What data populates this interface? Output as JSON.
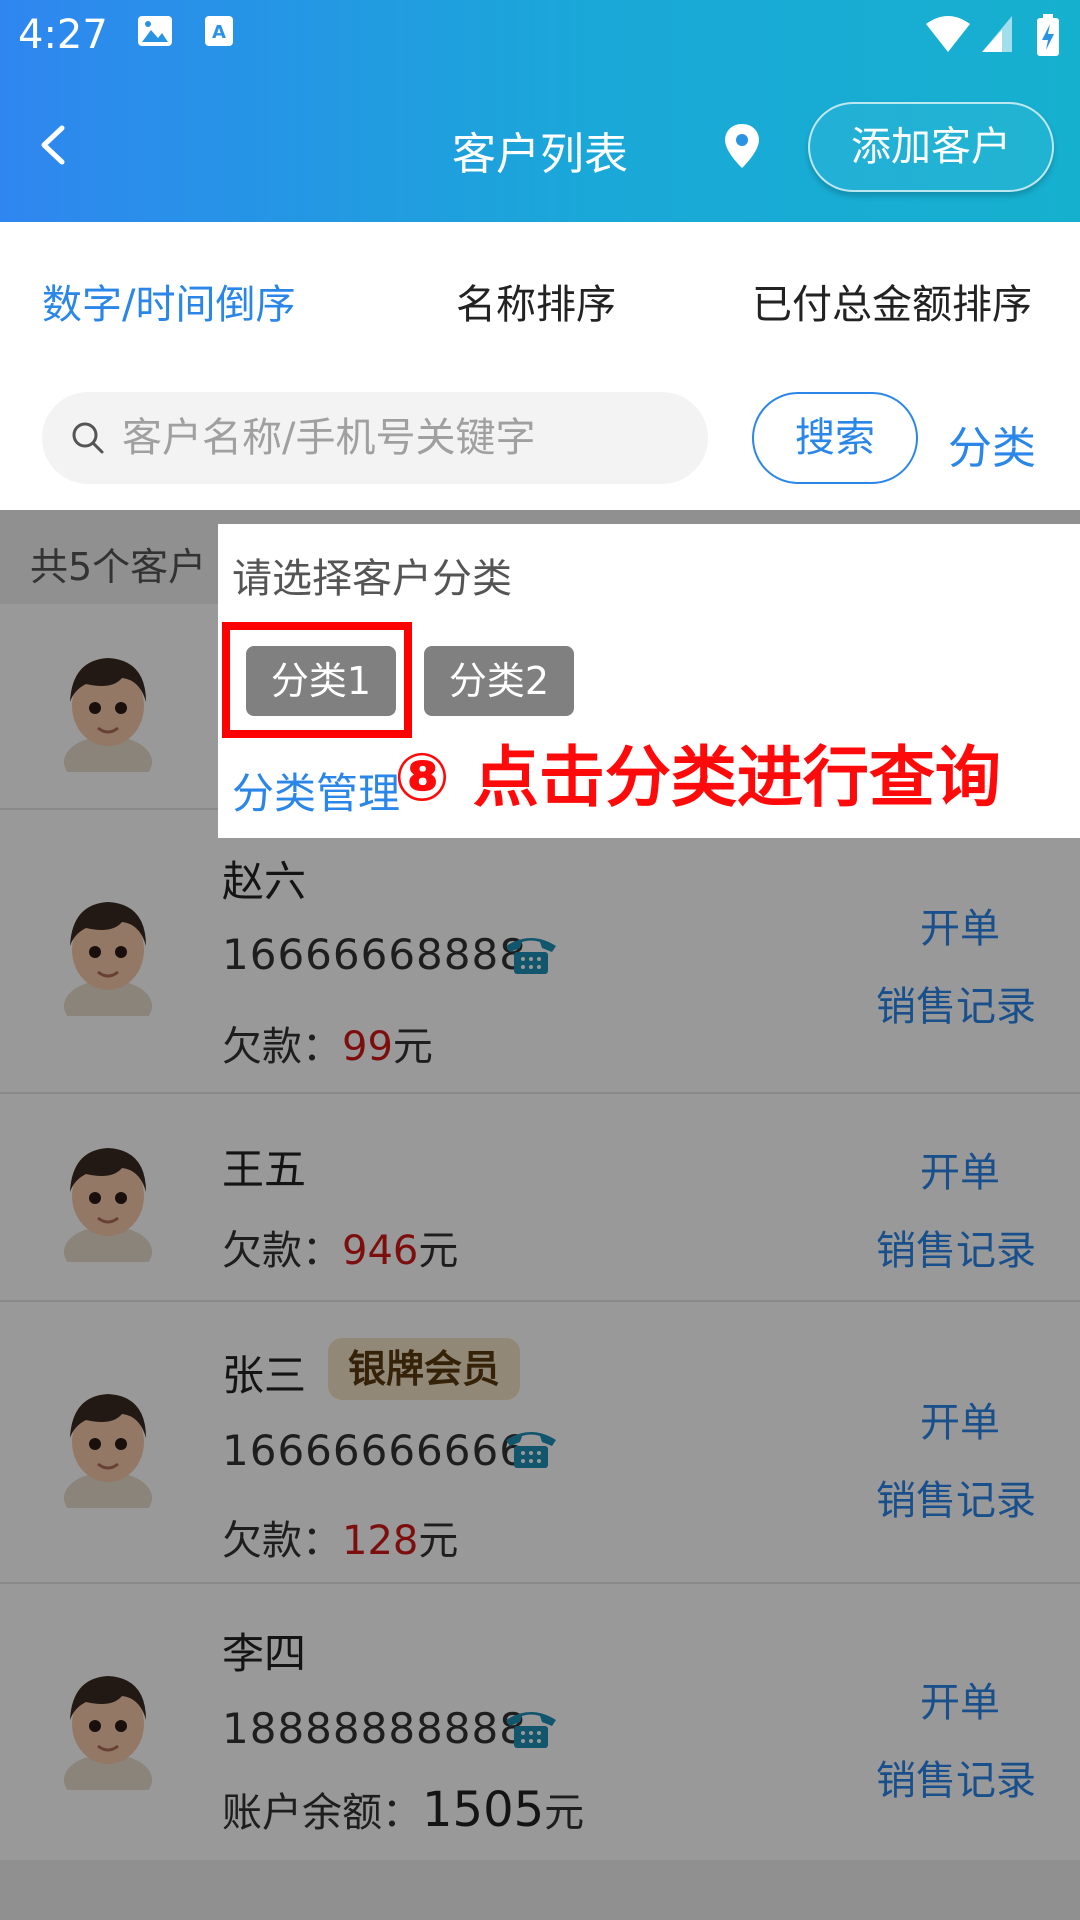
{
  "status_bar": {
    "time": "4:27"
  },
  "nav": {
    "title": "客户列表",
    "add_button": "添加客户"
  },
  "sort_tabs": [
    {
      "label": "数字/时间倒序",
      "active": true
    },
    {
      "label": "名称排序",
      "active": false
    },
    {
      "label": "已付总金额排序",
      "active": false
    }
  ],
  "search": {
    "placeholder": "客户名称/手机号关键字",
    "button": "搜索",
    "category_link": "分类"
  },
  "list": {
    "count_text": "共5个客户",
    "customers": [
      {
        "name": "赵六",
        "phone": "16666668888",
        "amount_label": "欠款：",
        "amount": "99",
        "unit": "元",
        "badge": ""
      },
      {
        "name": "王五",
        "phone": "",
        "amount_label": "欠款：",
        "amount": "946",
        "unit": "元",
        "badge": ""
      },
      {
        "name": "张三",
        "phone": "16666666666",
        "amount_label": "欠款：",
        "amount": "128",
        "unit": "元",
        "badge": "银牌会员"
      },
      {
        "name": "李四",
        "phone": "18888888888",
        "amount_label": "账户余额：",
        "amount": "1505",
        "unit": "元",
        "badge": ""
      }
    ],
    "action_open": "开单",
    "action_sales": "销售记录"
  },
  "popup": {
    "title": "请选择客户分类",
    "chips": [
      "分类1",
      "分类2"
    ],
    "manage_link": "分类管理",
    "annotation": "⑧ 点击分类进行查询"
  },
  "colors": {
    "accent": "#2a86e8",
    "debt": "#d01818",
    "highlight": "#ff0000"
  }
}
